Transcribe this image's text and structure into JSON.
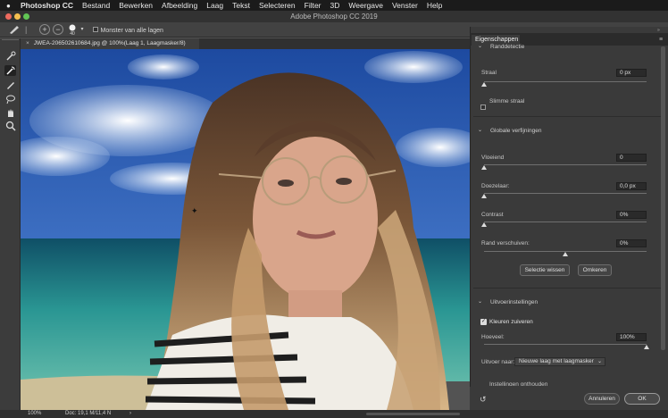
{
  "menubar": {
    "app_name": "Photoshop CC",
    "items": [
      "Bestand",
      "Bewerken",
      "Afbeelding",
      "Laag",
      "Tekst",
      "Selecteren",
      "Filter",
      "3D",
      "Weergave",
      "Venster",
      "Help"
    ]
  },
  "window": {
    "title": "Adobe Photoshop CC 2019"
  },
  "options": {
    "brush_size": "40",
    "sample_all_layers_label": "Monster van alle lagen",
    "sample_all_layers_checked": false
  },
  "document": {
    "tab_label": "JWEA-206502610684.jpg @ 100%(Laag 1, Laagmasker/8)"
  },
  "status": {
    "zoom": "100%",
    "doc_info": "Doc: 19,1 M/11,4 N"
  },
  "properties": {
    "tab_label": "Eigenschappen",
    "edge_detection": {
      "title": "Randdetectie",
      "radius_label": "Straal",
      "radius_value": "0 px",
      "radius_fraction": 0.0,
      "smart_radius_label": "Slimme straal",
      "smart_radius_checked": false
    },
    "global_refinements": {
      "title": "Globale verfijningen",
      "smooth_label": "Vloeiend",
      "smooth_value": "0",
      "smooth_fraction": 0.0,
      "feather_label": "Doezelaar:",
      "feather_value": "0,0 px",
      "feather_fraction": 0.0,
      "contrast_label": "Contrast",
      "contrast_value": "0%",
      "contrast_fraction": 0.0,
      "shift_edge_label": "Rand verschuiven:",
      "shift_edge_value": "0%",
      "shift_edge_fraction": 0.5,
      "clear_selection_label": "Selectie wissen",
      "invert_label": "Omkeren"
    },
    "output_settings": {
      "title": "Uitvoerinstellingen",
      "decontaminate_label": "Kleuren zuiveren",
      "decontaminate_checked": true,
      "amount_label": "Hoeveel:",
      "amount_value": "100%",
      "amount_fraction": 1.0,
      "output_to_label": "Uitvoer naar:",
      "output_to_value": "Nieuwe laag met laagmasker",
      "remember_label": "Instellingen onthouden"
    },
    "cancel_label": "Annuleren",
    "ok_label": "OK"
  },
  "colors": {
    "sky": "#2b57a7",
    "sea": "#1f7f86",
    "panel": "#3a3a3a",
    "menubar": "#1b1b1b"
  }
}
